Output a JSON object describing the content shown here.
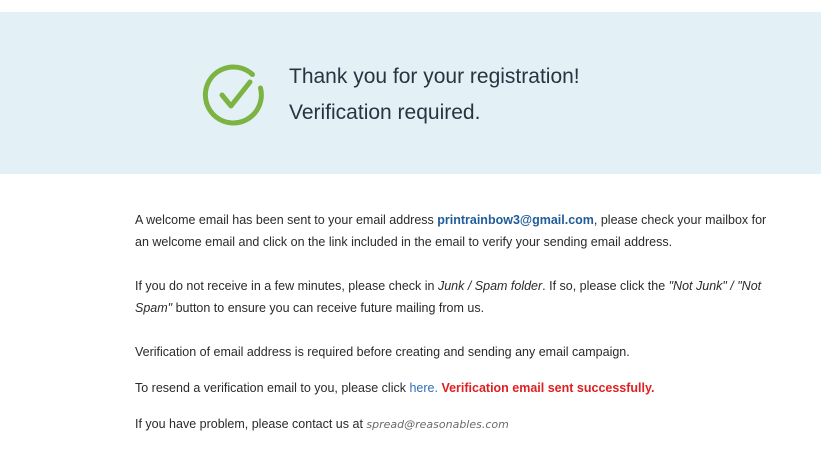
{
  "banner": {
    "title": "Thank you for your registration!",
    "subtitle": "Verification required.",
    "icon": "checkmark-circle-icon",
    "background_color": "#e3f1f7",
    "icon_color": "#7cb342"
  },
  "message": {
    "p1_before": "A welcome email has been sent to your email address ",
    "email": "printrainbow3@gmail.com",
    "p1_after": ", please check your mailbox for an welcome email and click on the link included in the email to verify your sending email address.",
    "p2_before": "If you do not receive in a few minutes, please check in ",
    "p2_folder": "Junk / Spam folder",
    "p2_middle": ". If so, please click the ",
    "p2_buttons": "\"Not Junk\" / \"Not Spam\"",
    "p2_after": " button to ensure you can receive future mailing from us.",
    "p3": "Verification of email address is required before creating and sending any email campaign.",
    "p4_before": "To resend a verification email to you, please click ",
    "p4_link": "here.",
    "p4_status": "Verification email sent successfully.",
    "p5_before": "If you have problem, please contact us at ",
    "p5_email": "spread@reasonables.com"
  },
  "colors": {
    "link": "#2f6db5",
    "email_highlight": "#1f5c99",
    "success": "#e02020"
  }
}
